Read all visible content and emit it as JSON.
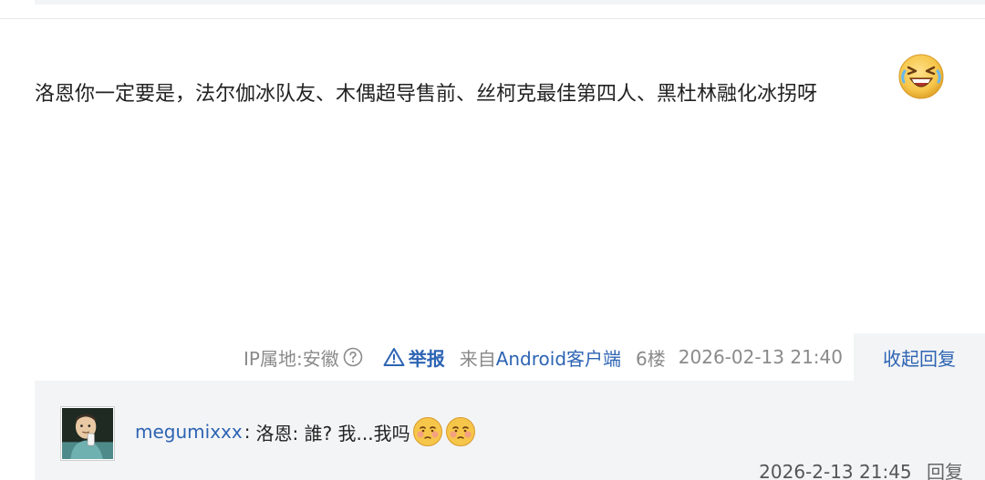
{
  "post": {
    "text": "洛恩你一定要是，法尔伽冰队友、木偶超导售前、丝柯克最佳第四人、黑杜林融化冰拐呀",
    "emoji": "laughing-tears-emoji"
  },
  "meta": {
    "ip_label": "IP属地:安徽",
    "report_label": "举报",
    "source_prefix": "来自",
    "source_client": "Android客户端",
    "floor": "6楼",
    "datetime": "2026-02-13 21:40",
    "collapse_label": "收起回复"
  },
  "reply": {
    "username": "megumixxx",
    "separator": ":",
    "message": "洛恩: 誰? 我...我吗",
    "emojis": [
      "shy-blush-emoji",
      "shy-blush-emoji"
    ],
    "datetime": "2026-2-13 21:45",
    "reply_label": "回复"
  },
  "colors": {
    "link_blue": "#2d64b3",
    "meta_gray": "#8a8a8a",
    "panel_bg": "#f3f4f6",
    "emoji_yellow": "#f6c64a"
  }
}
